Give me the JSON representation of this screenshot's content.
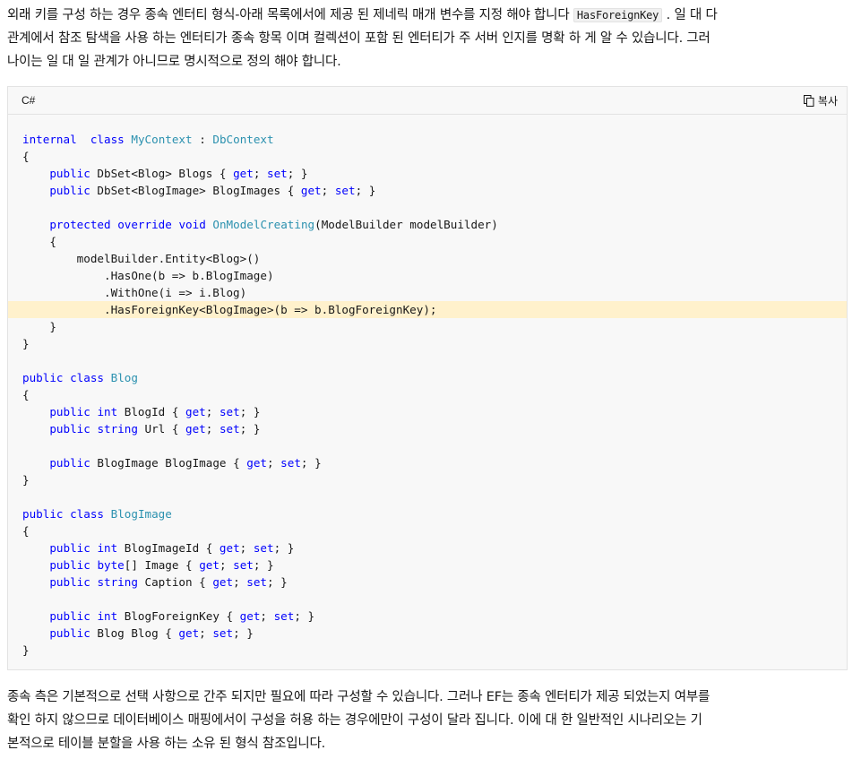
{
  "intro": {
    "line1_before": "외래 키를 구성 하는 경우 종속 엔터티 형식-아래 목록에서에 제공 된 제네릭 매개 변수를 지정 해야 합니다",
    "line1_code": "HasForeignKey",
    "line1_after": ". 일 대 다",
    "line2": "관계에서 참조 탐색을 사용 하는 엔터티가 종속 항목 이며 컬렉션이 포함 된 엔터티가 주 서버 인지를 명확 하 게 알 수 있습니다. 그러",
    "line3": "나이는 일 대 일 관계가 아니므로 명시적으로 정의 해야 합니다."
  },
  "code_block": {
    "language": "C#",
    "copy_label": "복사",
    "copy_icon": "copy-icon",
    "highlight_color": "#fff1cc",
    "lines": [
      [
        [
          "kw",
          "internal"
        ],
        [
          "",
          "  "
        ],
        [
          "kw",
          "class"
        ],
        [
          "",
          " "
        ],
        [
          "ty",
          "MyContext"
        ],
        [
          "",
          " : "
        ],
        [
          "ty",
          "DbContext"
        ]
      ],
      [
        [
          "",
          "{"
        ]
      ],
      [
        [
          "",
          "    "
        ],
        [
          "kw",
          "public"
        ],
        [
          "",
          " DbSet<Blog> Blogs { "
        ],
        [
          "ac",
          "get"
        ],
        [
          "",
          "; "
        ],
        [
          "ac",
          "set"
        ],
        [
          "",
          "; }"
        ]
      ],
      [
        [
          "",
          "    "
        ],
        [
          "kw",
          "public"
        ],
        [
          "",
          " DbSet<BlogImage> BlogImages { "
        ],
        [
          "ac",
          "get"
        ],
        [
          "",
          "; "
        ],
        [
          "ac",
          "set"
        ],
        [
          "",
          "; }"
        ]
      ],
      [],
      [
        [
          "",
          "    "
        ],
        [
          "kw",
          "protected"
        ],
        [
          "",
          " "
        ],
        [
          "kw",
          "override"
        ],
        [
          "",
          " "
        ],
        [
          "kw",
          "void"
        ],
        [
          "",
          " "
        ],
        [
          "mth",
          "OnModelCreating"
        ],
        [
          "",
          "(ModelBuilder modelBuilder)"
        ]
      ],
      [
        [
          "",
          "    {"
        ]
      ],
      [
        [
          "",
          "        modelBuilder.Entity<Blog>()"
        ]
      ],
      [
        [
          "",
          "            .HasOne(b => b.BlogImage)"
        ]
      ],
      [
        [
          "",
          "            .WithOne(i => i.Blog)"
        ]
      ],
      [
        [
          "",
          "            .HasForeignKey<BlogImage>(b => b.BlogForeignKey);"
        ]
      ],
      [
        [
          "",
          "    }"
        ]
      ],
      [
        [
          "",
          "}"
        ]
      ],
      [],
      [
        [
          "kw",
          "public"
        ],
        [
          "",
          " "
        ],
        [
          "kw",
          "class"
        ],
        [
          "",
          " "
        ],
        [
          "ty",
          "Blog"
        ]
      ],
      [
        [
          "",
          "{"
        ]
      ],
      [
        [
          "",
          "    "
        ],
        [
          "kw",
          "public"
        ],
        [
          "",
          " "
        ],
        [
          "kw",
          "int"
        ],
        [
          "",
          " BlogId { "
        ],
        [
          "ac",
          "get"
        ],
        [
          "",
          "; "
        ],
        [
          "ac",
          "set"
        ],
        [
          "",
          "; }"
        ]
      ],
      [
        [
          "",
          "    "
        ],
        [
          "kw",
          "public"
        ],
        [
          "",
          " "
        ],
        [
          "kw",
          "string"
        ],
        [
          "",
          " Url { "
        ],
        [
          "ac",
          "get"
        ],
        [
          "",
          "; "
        ],
        [
          "ac",
          "set"
        ],
        [
          "",
          "; }"
        ]
      ],
      [],
      [
        [
          "",
          "    "
        ],
        [
          "kw",
          "public"
        ],
        [
          "",
          " BlogImage BlogImage { "
        ],
        [
          "ac",
          "get"
        ],
        [
          "",
          "; "
        ],
        [
          "ac",
          "set"
        ],
        [
          "",
          "; }"
        ]
      ],
      [
        [
          "",
          "}"
        ]
      ],
      [],
      [
        [
          "kw",
          "public"
        ],
        [
          "",
          " "
        ],
        [
          "kw",
          "class"
        ],
        [
          "",
          " "
        ],
        [
          "ty",
          "BlogImage"
        ]
      ],
      [
        [
          "",
          "{"
        ]
      ],
      [
        [
          "",
          "    "
        ],
        [
          "kw",
          "public"
        ],
        [
          "",
          " "
        ],
        [
          "kw",
          "int"
        ],
        [
          "",
          " BlogImageId { "
        ],
        [
          "ac",
          "get"
        ],
        [
          "",
          "; "
        ],
        [
          "ac",
          "set"
        ],
        [
          "",
          "; }"
        ]
      ],
      [
        [
          "",
          "    "
        ],
        [
          "kw",
          "public"
        ],
        [
          "",
          " "
        ],
        [
          "kw",
          "byte"
        ],
        [
          "",
          "[] Image { "
        ],
        [
          "ac",
          "get"
        ],
        [
          "",
          "; "
        ],
        [
          "ac",
          "set"
        ],
        [
          "",
          "; }"
        ]
      ],
      [
        [
          "",
          "    "
        ],
        [
          "kw",
          "public"
        ],
        [
          "",
          " "
        ],
        [
          "kw",
          "string"
        ],
        [
          "",
          " Caption { "
        ],
        [
          "ac",
          "get"
        ],
        [
          "",
          "; "
        ],
        [
          "ac",
          "set"
        ],
        [
          "",
          "; }"
        ]
      ],
      [],
      [
        [
          "",
          "    "
        ],
        [
          "kw",
          "public"
        ],
        [
          "",
          " "
        ],
        [
          "kw",
          "int"
        ],
        [
          "",
          " BlogForeignKey { "
        ],
        [
          "ac",
          "get"
        ],
        [
          "",
          "; "
        ],
        [
          "ac",
          "set"
        ],
        [
          "",
          "; }"
        ]
      ],
      [
        [
          "",
          "    "
        ],
        [
          "kw",
          "public"
        ],
        [
          "",
          " Blog Blog { "
        ],
        [
          "ac",
          "get"
        ],
        [
          "",
          "; "
        ],
        [
          "ac",
          "set"
        ],
        [
          "",
          "; }"
        ]
      ],
      [
        [
          "",
          "}"
        ]
      ]
    ],
    "highlighted_line_index": 10
  },
  "outro": {
    "line1": "종속 측은 기본적으로 선택 사항으로 간주 되지만 필요에 따라 구성할 수 있습니다. 그러나 EF는 종속 엔터티가 제공 되었는지 여부를",
    "line2": "확인 하지 않으므로 데이터베이스 매핑에서이 구성을 허용 하는 경우에만이 구성이 달라 집니다. 이에 대 한 일반적인 시나리오는 기",
    "line3": "본적으로 테이블 분할을 사용 하는 소유 된 형식 참조입니다."
  }
}
